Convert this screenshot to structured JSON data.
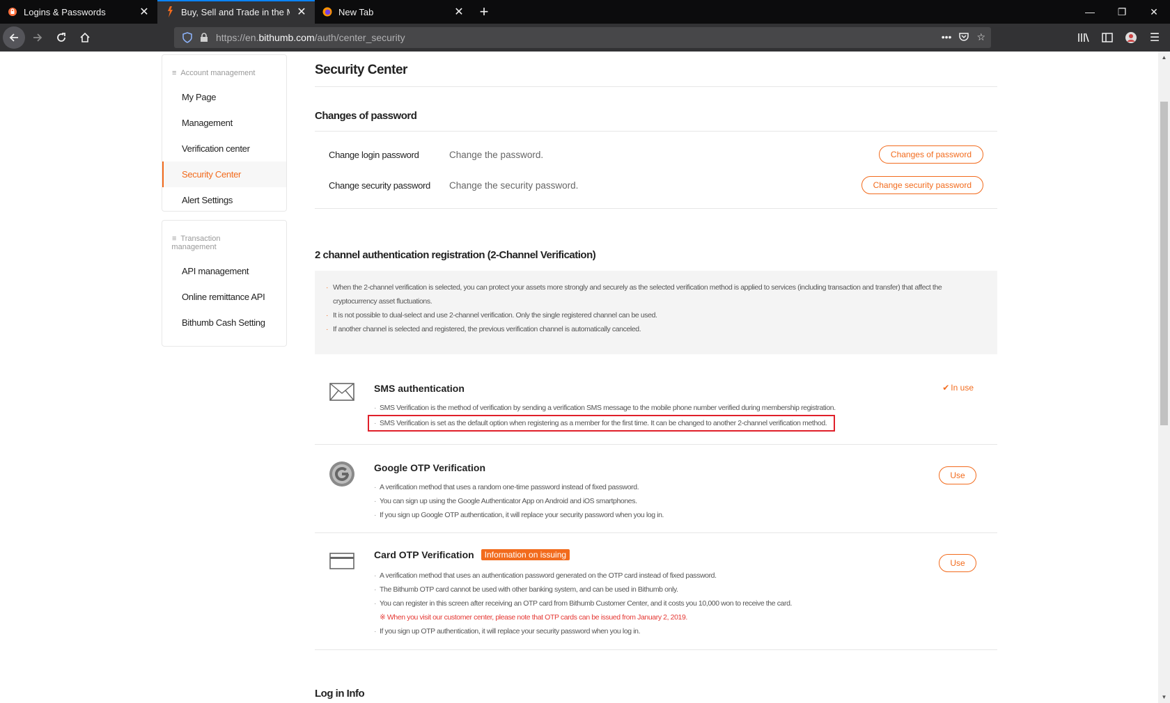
{
  "browser": {
    "tabs": [
      {
        "title": "Logins & Passwords",
        "active": false
      },
      {
        "title": "Buy, Sell and Trade in the Most",
        "active": true
      },
      {
        "title": "New Tab",
        "active": false
      }
    ],
    "url_prefix": "https://en.",
    "url_domain": "bithumb.com",
    "url_path": "/auth/center_security"
  },
  "sidebar": {
    "group1": "Account management",
    "group1_items": [
      "My Page",
      "Management",
      "Verification center",
      "Security Center",
      "Alert Settings"
    ],
    "group2_line1": "Transaction",
    "group2_line2": "management",
    "group2_items": [
      "API management",
      "Online remittance API",
      "Bithumb Cash Setting"
    ]
  },
  "main": {
    "title": "Security Center",
    "password_section": {
      "title": "Changes of password",
      "rows": [
        {
          "label": "Change login password",
          "desc": "Change the password.",
          "button": "Changes of password"
        },
        {
          "label": "Change security password",
          "desc": "Change the security password.",
          "button": "Change security password"
        }
      ]
    },
    "two_channel": {
      "title": "2 channel authentication registration (2-Channel Verification)",
      "notices": [
        "When the 2-channel verification is selected, you can protect your assets more strongly and securely as the selected verification method is applied to services (including transaction and transfer) that affect the",
        "cryptocurrency asset fluctuations.",
        "It is not possible to dual-select and use 2-channel verification. Only the single registered channel can be used.",
        "If another channel is selected and registered, the previous verification channel is automatically canceled."
      ]
    },
    "methods": {
      "sms": {
        "title": "SMS authentication",
        "status": "In use",
        "lines": [
          "SMS Verification is the method of verification by sending a verification SMS message to the mobile phone number verified during membership registration.",
          "SMS Verification is set as the default option when registering as a member for the first time. It can be changed to another 2-channel verification method."
        ]
      },
      "google": {
        "title": "Google OTP Verification",
        "button": "Use",
        "lines": [
          "A verification method that uses a random one-time password instead of fixed password.",
          "You can sign up using the Google Authenticator App on Android and iOS smartphones.",
          "If you sign up Google OTP authentication, it will replace your security password when you log in."
        ]
      },
      "card": {
        "title": "Card OTP Verification",
        "badge": "Information on issuing",
        "button": "Use",
        "lines": [
          "A verification method that uses an authentication password generated on the OTP card instead of fixed password.",
          "The Bithumb OTP card cannot be used with other banking system, and can be used in Bithumb only.",
          "You can register in this screen after receiving an OTP card from Bithumb Customer Center, and it costs you 10,000 won to receive the card."
        ],
        "red_note": "※ When you visit our customer center, please note that OTP cards can be issued from January 2, 2019.",
        "last_line": "If you sign up OTP authentication, it will replace your security password when you log in."
      }
    },
    "login_info_title": "Log in Info"
  },
  "colors": {
    "accent": "#f26b1d",
    "highlight": "#e0202a"
  }
}
